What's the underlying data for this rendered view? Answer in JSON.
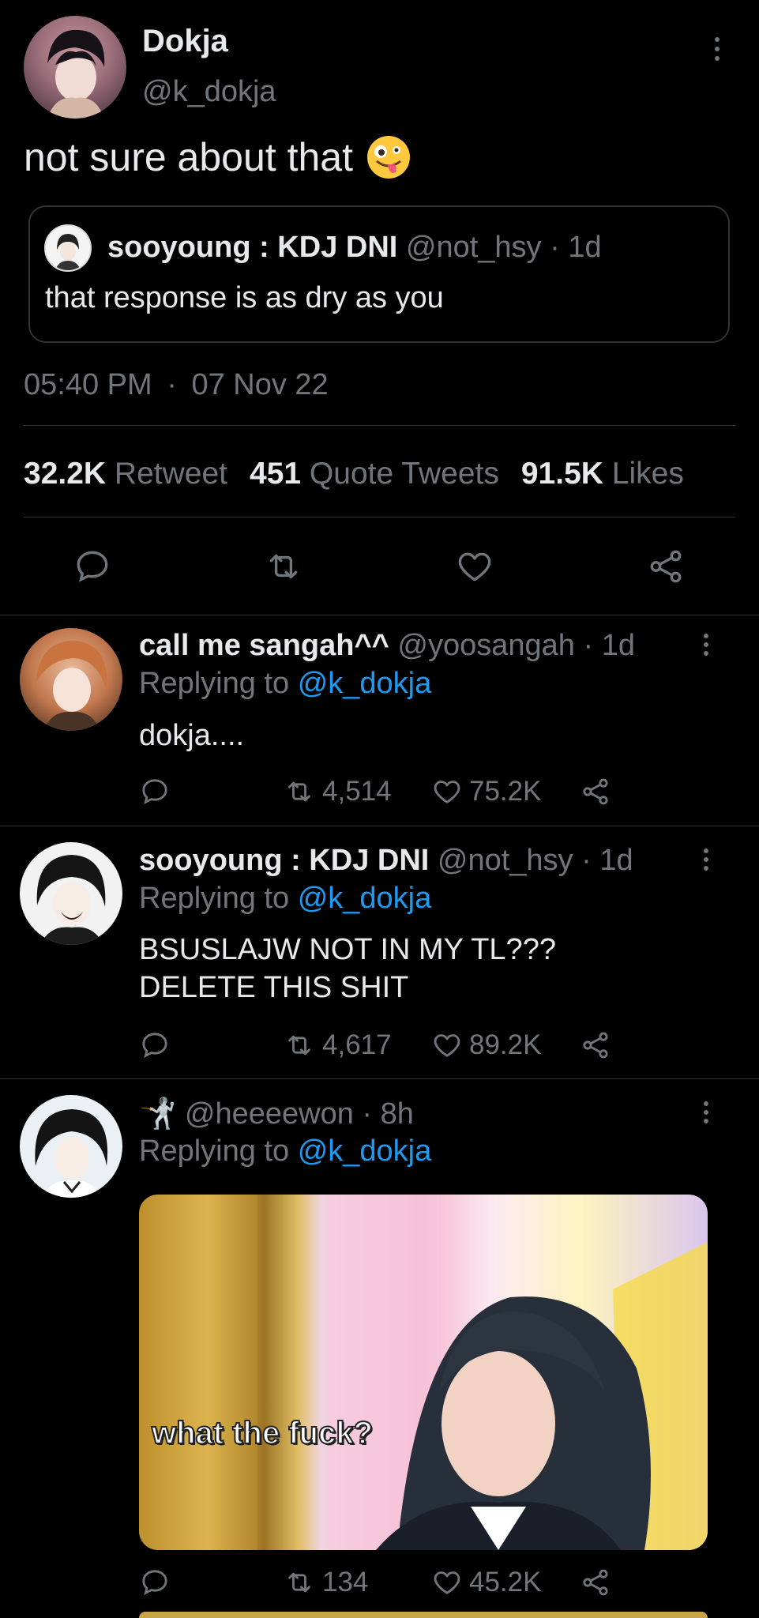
{
  "main_tweet": {
    "display_name": "Dokja",
    "handle": "@k_dokja",
    "text": "not sure about that",
    "emoji": "zany-face",
    "quote": {
      "display_name": "sooyoung : KDJ DNI",
      "handle": "@not_hsy",
      "separator": "·",
      "age": "1d",
      "text": "that response is as dry as you"
    },
    "time": "05:40 PM",
    "dot": "·",
    "date": "07 Nov 22",
    "stats": {
      "retweets_count": "32.2K",
      "retweets_label": "Retweet",
      "quotes_count": "451",
      "quotes_label": "Quote Tweets",
      "likes_count": "91.5K",
      "likes_label": "Likes"
    }
  },
  "replies": [
    {
      "display_name": "call me sangah^^",
      "handle": "@yoosangah",
      "separator": "·",
      "age": "1d",
      "replying_label": "Replying to",
      "replying_handle": "@k_dokja",
      "text_line1": "dokja....",
      "retweets": "4,514",
      "likes": "75.2K"
    },
    {
      "display_name": "sooyoung : KDJ DNI",
      "handle": "@not_hsy",
      "separator": "·",
      "age": "1d",
      "replying_label": "Replying to",
      "replying_handle": "@k_dokja",
      "text_line1": "BSUSLAJW NOT IN MY TL???",
      "text_line2": "DELETE THIS SHIT",
      "retweets": "4,617",
      "likes": "89.2K"
    },
    {
      "display_name": "🤺",
      "handle": "@heeeewon",
      "separator": "·",
      "age": "8h",
      "replying_label": "Replying to",
      "replying_handle": "@k_dokja",
      "media_caption": "what the fuck?",
      "retweets": "134",
      "likes": "45.2K"
    }
  ],
  "colors": {
    "background": "#000000",
    "text": "#e7e9ea",
    "muted": "#71767b",
    "link": "#1d9bf0",
    "divider": "#2f3336"
  }
}
